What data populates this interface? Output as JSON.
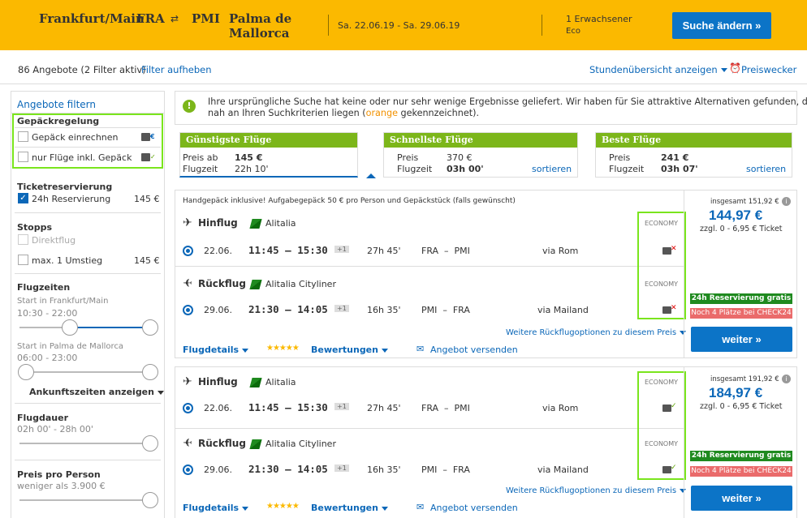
{
  "header": {
    "origin_city": "Frankfurt/Main",
    "origin_code": "FRA",
    "swap_icon": "⇄",
    "dest_code": "PMI",
    "dest_city_1": "Palma de",
    "dest_city_2": "Mallorca",
    "dates": "Sa. 22.06.19 - Sa. 29.06.19",
    "travellers": "1 Erwachsener",
    "cabin": "Eco",
    "change_search": "Suche ändern »"
  },
  "results_bar": {
    "count_text": "86 Angebote (2 Filter aktiv)",
    "reset_filter": "Filter aufheben",
    "hour_overview": "Stundenübersicht anzeigen",
    "price_alert": "Preiswecker"
  },
  "sidebar": {
    "title": "Angebote filtern",
    "baggage": {
      "heading": "Gepäckregelung",
      "opt1": "Gepäck einrechnen",
      "opt2": "nur Flüge inkl. Gepäck"
    },
    "ticket": {
      "heading": "Ticketreservierung",
      "opt1": "24h Reservierung",
      "opt1_price": "145 €"
    },
    "stops": {
      "heading": "Stopps",
      "opt1": "Direktflug",
      "opt2": "max. 1 Umstieg",
      "opt2_price": "145 €"
    },
    "times": {
      "heading": "Flugzeiten",
      "start1_label": "Start in Frankfurt/Main",
      "start1_range": "10:30 - 22:00",
      "start2_label": "Start in Palma de Mallorca",
      "start2_range": "06:00 - 23:00",
      "arrival_toggle": "Ankunftszeiten anzeigen"
    },
    "duration": {
      "heading": "Flugdauer",
      "range": "02h 00' - 28h 00'"
    },
    "price": {
      "heading": "Preis pro Person",
      "range": "weniger als 3.900 €"
    }
  },
  "notice": {
    "text1": "Ihre ursprüngliche Suche hat keine oder nur sehr wenige Ergebnisse geliefert. Wir haben für Sie attraktive Alternativen gefunden, die",
    "text2a": "nah an Ihren Suchkriterien liegen (",
    "text2_orange": "orange",
    "text2b": " gekennzeichnet)."
  },
  "tabs": [
    {
      "title": "Günstigste Flüge",
      "price_label": "Preis ab",
      "price": "145 €",
      "time_label": "Flugzeit",
      "time": "22h 10'"
    },
    {
      "title": "Schnellste Flüge",
      "price_label": "Preis",
      "price": "370 €",
      "time_label": "Flugzeit",
      "time": "03h 00'",
      "sort": "sortieren"
    },
    {
      "title": "Beste Flüge",
      "price_label": "Preis",
      "price": "241 €",
      "time_label": "Flugzeit",
      "time": "03h 07'",
      "sort": "sortieren"
    }
  ],
  "offers": [
    {
      "baggage_note": "Handgepäck inklusive! Aufgabegepäck 50 € pro Person und Gepäckstück (falls gewünscht)",
      "outbound": {
        "label": "Hinflug",
        "airline": "Alitalia",
        "cabin": "ECONOMY",
        "date": "22.06.",
        "times": "11:45 – 15:30",
        "plus": "+1",
        "duration": "27h 45'",
        "route": "FRA  –  PMI",
        "via": "via Rom"
      },
      "return": {
        "label": "Rückflug",
        "airline": "Alitalia Cityliner",
        "cabin": "ECONOMY",
        "date": "29.06.",
        "times": "21:30 – 14:05",
        "plus": "+1",
        "duration": "16h 35'",
        "route": "PMI  –  FRA",
        "via": "via Mailand"
      },
      "more_options": "Weitere Rückflugoptionen zu diesem Preis",
      "total": "insgesamt 151,92 €",
      "price": "144,97 €",
      "fee": "zzgl. 0 - 6,95 € Ticket",
      "badge_green": "24h Reservierung gratis",
      "badge_red": "Noch 4 Plätze bei CHECK24",
      "continue": "weiter »",
      "details": "Flugdetails",
      "stars": "★★★★★",
      "ratings": "Bewertungen",
      "send": "Angebot versenden"
    },
    {
      "outbound": {
        "label": "Hinflug",
        "airline": "Alitalia",
        "cabin": "ECONOMY",
        "date": "22.06.",
        "times": "11:45 – 15:30",
        "plus": "+1",
        "duration": "27h 45'",
        "route": "FRA  –  PMI",
        "via": "via Rom"
      },
      "return": {
        "label": "Rückflug",
        "airline": "Alitalia Cityliner",
        "cabin": "ECONOMY",
        "date": "29.06.",
        "times": "21:30 – 14:05",
        "plus": "+1",
        "duration": "16h 35'",
        "route": "PMI  –  FRA",
        "via": "via Mailand"
      },
      "more_options": "Weitere Rückflugoptionen zu diesem Preis",
      "total": "insgesamt 191,92 €",
      "price": "184,97 €",
      "fee": "zzgl. 0 - 6,95 € Ticket",
      "badge_green": "24h Reservierung gratis",
      "badge_red": "Noch 4 Plätze bei CHECK24",
      "continue": "weiter »",
      "details": "Flugdetails",
      "stars": "★★★★★",
      "ratings": "Bewertungen",
      "send": "Angebot versenden"
    }
  ],
  "colors": {
    "header_bg": "#fbb900",
    "accent_blue": "#0c74c7",
    "tab_green": "#7cb61a",
    "highlight_green": "#7ae51d"
  },
  "icons": {
    "info": "info-icon",
    "plane_out": "plane-outbound-icon",
    "plane_in": "plane-return-icon",
    "alarm": "alarm-clock-icon"
  }
}
